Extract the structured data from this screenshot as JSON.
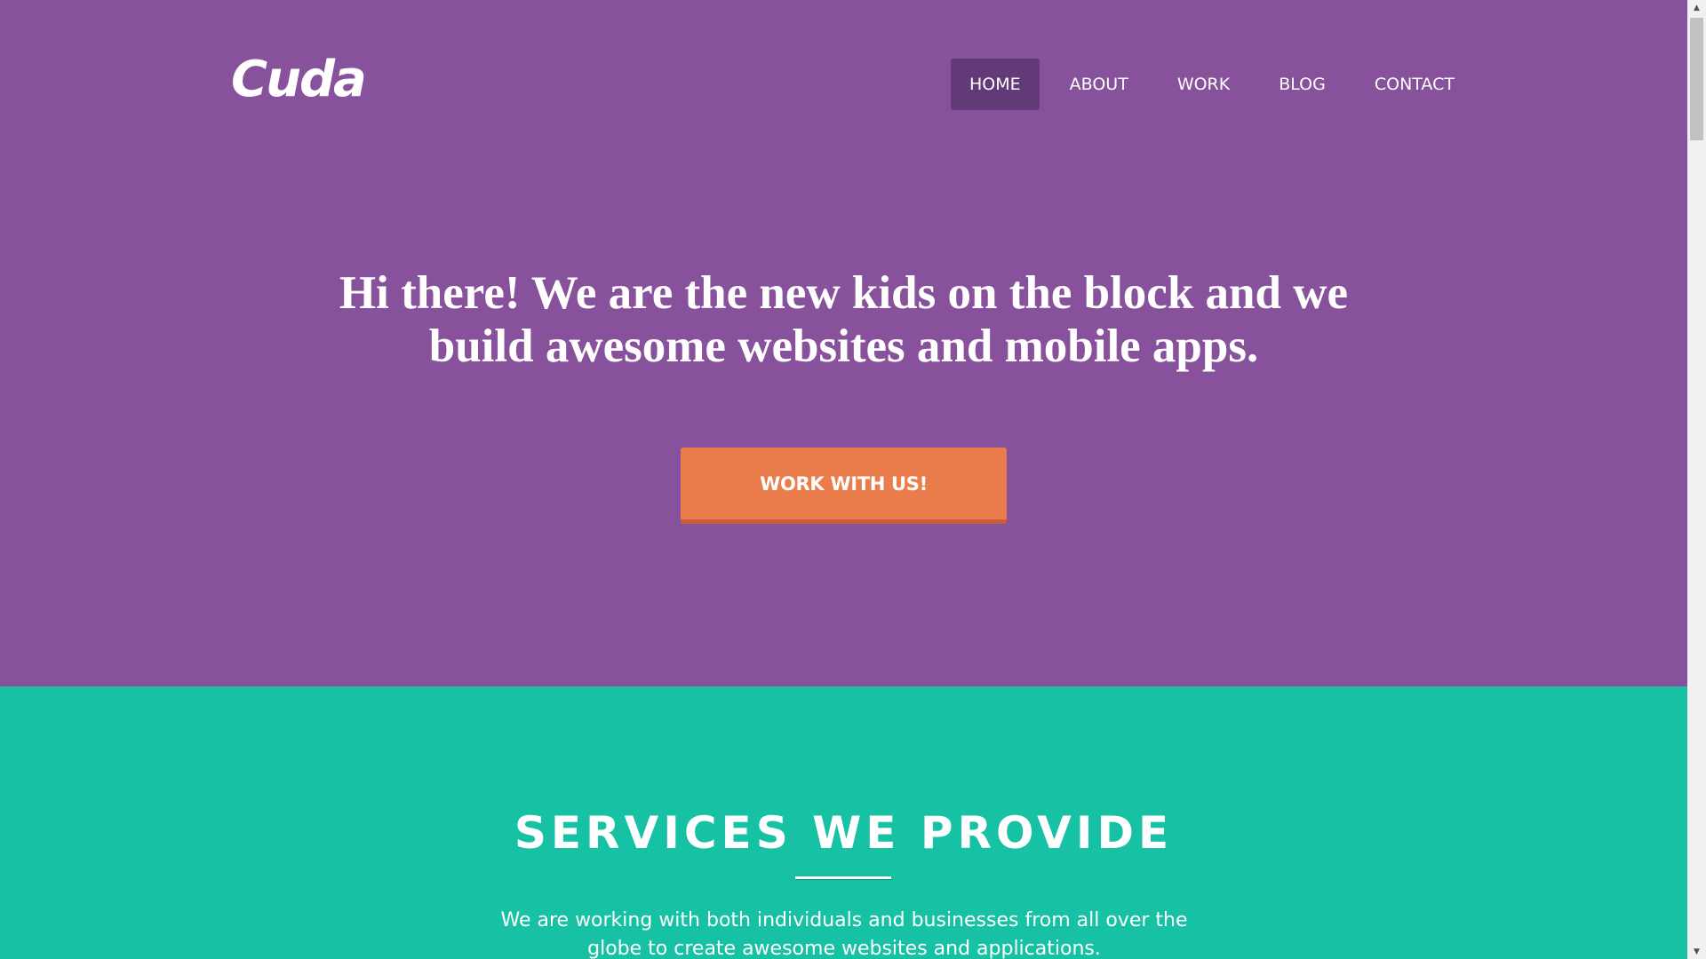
{
  "brand": {
    "logo_text": "Cuda"
  },
  "nav": {
    "items": [
      {
        "label": "HOME",
        "active": true
      },
      {
        "label": "ABOUT",
        "active": false
      },
      {
        "label": "WORK",
        "active": false
      },
      {
        "label": "BLOG",
        "active": false
      },
      {
        "label": "CONTACT",
        "active": false
      }
    ]
  },
  "hero": {
    "headline": "Hi there! We are the new kids on the block and we build awesome websites and mobile apps.",
    "cta_label": "WORK WITH US!"
  },
  "services": {
    "title": "SERVICES WE PROVIDE",
    "description": "We are working with both individuals and businesses from all over the globe to create awesome websites and applications."
  },
  "scrollbar": {
    "up_arrow": "▲",
    "down_arrow": "▼"
  },
  "colors": {
    "hero_bg": "#87529b",
    "nav_active_bg": "#633a78",
    "cta_bg": "#ea7d4b",
    "services_bg": "#17c1a4",
    "text": "#ffffff"
  }
}
